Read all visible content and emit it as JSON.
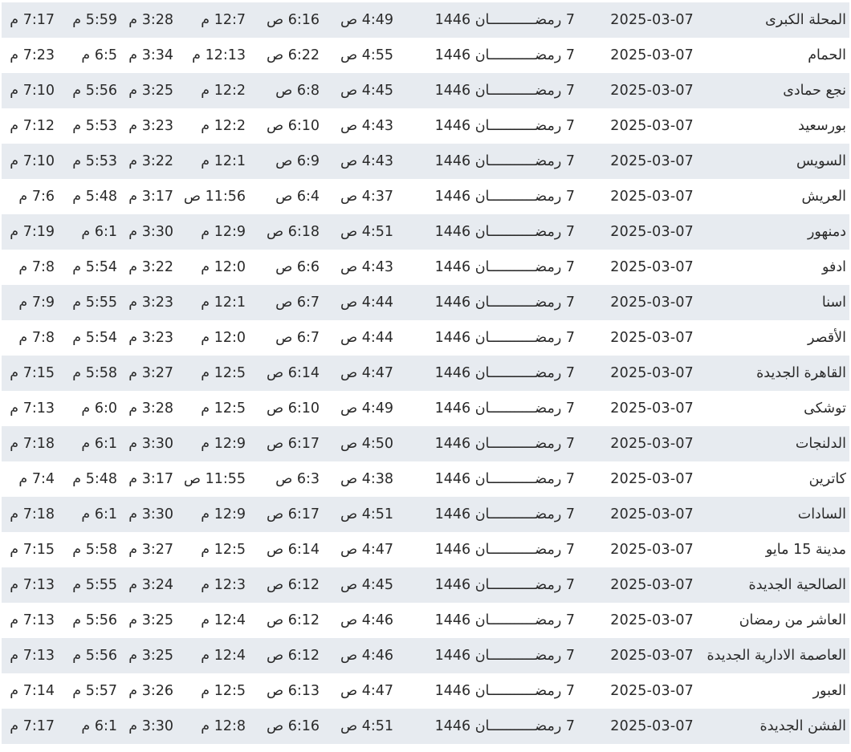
{
  "rows": [
    {
      "city": "المحلة الكبرى",
      "gregorian": "2025-03-07",
      "hijri": "7 رمضـــــــــــان 1446",
      "fajr": "4:49 ص",
      "sunrise": "6:16 ص",
      "dhuhr": "12:7 م",
      "asr": "3:28 م",
      "maghrib": "5:59 م",
      "isha": "7:17 م"
    },
    {
      "city": "الحمام",
      "gregorian": "2025-03-07",
      "hijri": "7 رمضـــــــــــان 1446",
      "fajr": "4:55 ص",
      "sunrise": "6:22 ص",
      "dhuhr": "12:13 م",
      "asr": "3:34 م",
      "maghrib": "6:5 م",
      "isha": "7:23 م"
    },
    {
      "city": "نجع حمادى",
      "gregorian": "2025-03-07",
      "hijri": "7 رمضـــــــــــان 1446",
      "fajr": "4:45 ص",
      "sunrise": "6:8 ص",
      "dhuhr": "12:2 م",
      "asr": "3:25 م",
      "maghrib": "5:56 م",
      "isha": "7:10 م"
    },
    {
      "city": "بورسعيد",
      "gregorian": "2025-03-07",
      "hijri": "7 رمضـــــــــــان 1446",
      "fajr": "4:43 ص",
      "sunrise": "6:10 ص",
      "dhuhr": "12:2 م",
      "asr": "3:23 م",
      "maghrib": "5:53 م",
      "isha": "7:12 م"
    },
    {
      "city": "السويس",
      "gregorian": "2025-03-07",
      "hijri": "7 رمضـــــــــــان 1446",
      "fajr": "4:43 ص",
      "sunrise": "6:9 ص",
      "dhuhr": "12:1 م",
      "asr": "3:22 م",
      "maghrib": "5:53 م",
      "isha": "7:10 م"
    },
    {
      "city": "العريش",
      "gregorian": "2025-03-07",
      "hijri": "7 رمضـــــــــــان 1446",
      "fajr": "4:37 ص",
      "sunrise": "6:4 ص",
      "dhuhr": "11:56 ص",
      "asr": "3:17 م",
      "maghrib": "5:48 م",
      "isha": "7:6 م"
    },
    {
      "city": "دمنهور",
      "gregorian": "2025-03-07",
      "hijri": "7 رمضـــــــــــان 1446",
      "fajr": "4:51 ص",
      "sunrise": "6:18 ص",
      "dhuhr": "12:9 م",
      "asr": "3:30 م",
      "maghrib": "6:1 م",
      "isha": "7:19 م"
    },
    {
      "city": "ادفو",
      "gregorian": "2025-03-07",
      "hijri": "7 رمضـــــــــــان 1446",
      "fajr": "4:43 ص",
      "sunrise": "6:6 ص",
      "dhuhr": "12:0 م",
      "asr": "3:22 م",
      "maghrib": "5:54 م",
      "isha": "7:8 م"
    },
    {
      "city": "اسنا",
      "gregorian": "2025-03-07",
      "hijri": "7 رمضـــــــــــان 1446",
      "fajr": "4:44 ص",
      "sunrise": "6:7 ص",
      "dhuhr": "12:1 م",
      "asr": "3:23 م",
      "maghrib": "5:55 م",
      "isha": "7:9 م"
    },
    {
      "city": "الأقصر",
      "gregorian": "2025-03-07",
      "hijri": "7 رمضـــــــــــان 1446",
      "fajr": "4:44 ص",
      "sunrise": "6:7 ص",
      "dhuhr": "12:0 م",
      "asr": "3:23 م",
      "maghrib": "5:54 م",
      "isha": "7:8 م"
    },
    {
      "city": "القاهرة الجديدة",
      "gregorian": "2025-03-07",
      "hijri": "7 رمضـــــــــــان 1446",
      "fajr": "4:47 ص",
      "sunrise": "6:14 ص",
      "dhuhr": "12:5 م",
      "asr": "3:27 م",
      "maghrib": "5:58 م",
      "isha": "7:15 م"
    },
    {
      "city": "توشكى",
      "gregorian": "2025-03-07",
      "hijri": "7 رمضـــــــــــان 1446",
      "fajr": "4:49 ص",
      "sunrise": "6:10 ص",
      "dhuhr": "12:5 م",
      "asr": "3:28 م",
      "maghrib": "6:0 م",
      "isha": "7:13 م"
    },
    {
      "city": "الدلنجات",
      "gregorian": "2025-03-07",
      "hijri": "7 رمضـــــــــــان 1446",
      "fajr": "4:50 ص",
      "sunrise": "6:17 ص",
      "dhuhr": "12:9 م",
      "asr": "3:30 م",
      "maghrib": "6:1 م",
      "isha": "7:18 م"
    },
    {
      "city": "كاترين",
      "gregorian": "2025-03-07",
      "hijri": "7 رمضـــــــــــان 1446",
      "fajr": "4:38 ص",
      "sunrise": "6:3 ص",
      "dhuhr": "11:55 ص",
      "asr": "3:17 م",
      "maghrib": "5:48 م",
      "isha": "7:4 م"
    },
    {
      "city": "السادات",
      "gregorian": "2025-03-07",
      "hijri": "7 رمضـــــــــــان 1446",
      "fajr": "4:51 ص",
      "sunrise": "6:17 ص",
      "dhuhr": "12:9 م",
      "asr": "3:30 م",
      "maghrib": "6:1 م",
      "isha": "7:18 م"
    },
    {
      "city": "مدينة 15 مايو",
      "gregorian": "2025-03-07",
      "hijri": "7 رمضـــــــــــان 1446",
      "fajr": "4:47 ص",
      "sunrise": "6:14 ص",
      "dhuhr": "12:5 م",
      "asr": "3:27 م",
      "maghrib": "5:58 م",
      "isha": "7:15 م"
    },
    {
      "city": "الصالحية الجديدة",
      "gregorian": "2025-03-07",
      "hijri": "7 رمضـــــــــــان 1446",
      "fajr": "4:45 ص",
      "sunrise": "6:12 ص",
      "dhuhr": "12:3 م",
      "asr": "3:24 م",
      "maghrib": "5:55 م",
      "isha": "7:13 م"
    },
    {
      "city": "العاشر من رمضان",
      "gregorian": "2025-03-07",
      "hijri": "7 رمضـــــــــــان 1446",
      "fajr": "4:46 ص",
      "sunrise": "6:12 ص",
      "dhuhr": "12:4 م",
      "asr": "3:25 م",
      "maghrib": "5:56 م",
      "isha": "7:13 م"
    },
    {
      "city": "العاصمة الادارية الجديدة",
      "gregorian": "2025-03-07",
      "hijri": "7 رمضـــــــــــان 1446",
      "fajr": "4:46 ص",
      "sunrise": "6:12 ص",
      "dhuhr": "12:4 م",
      "asr": "3:25 م",
      "maghrib": "5:56 م",
      "isha": "7:13 م"
    },
    {
      "city": "العبور",
      "gregorian": "2025-03-07",
      "hijri": "7 رمضـــــــــــان 1446",
      "fajr": "4:47 ص",
      "sunrise": "6:13 ص",
      "dhuhr": "12:5 م",
      "asr": "3:26 م",
      "maghrib": "5:57 م",
      "isha": "7:14 م"
    },
    {
      "city": "الفشن الجديدة",
      "gregorian": "2025-03-07",
      "hijri": "7 رمضـــــــــــان 1446",
      "fajr": "4:51 ص",
      "sunrise": "6:16 ص",
      "dhuhr": "12:8 م",
      "asr": "3:30 م",
      "maghrib": "6:1 م",
      "isha": "7:17 م"
    }
  ],
  "colors": {
    "row_alt_bg": "#e7ebf0",
    "row_bg": "#ffffff",
    "text": "#2a2a2a"
  }
}
